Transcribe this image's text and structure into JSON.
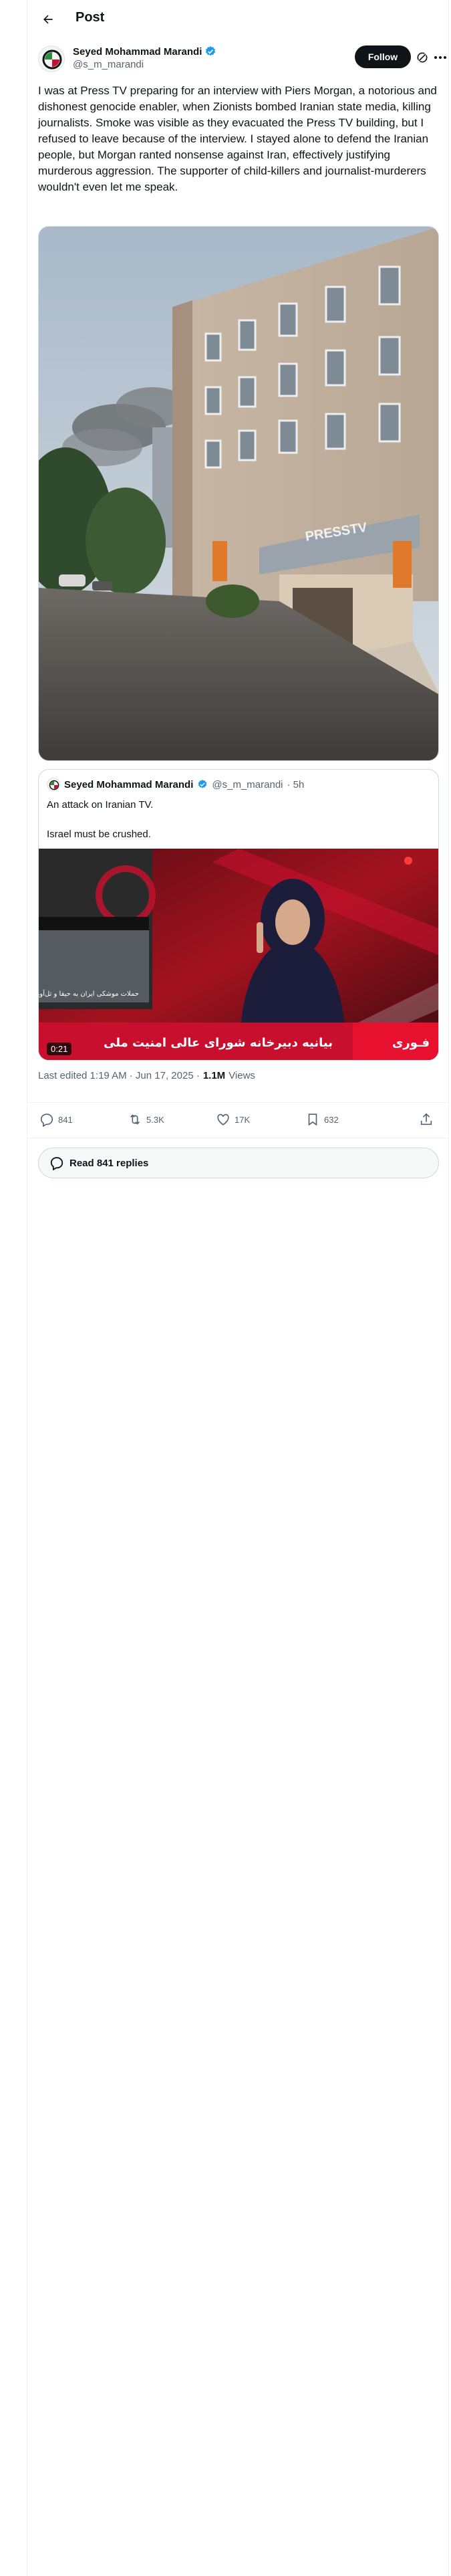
{
  "header": {
    "title": "Post"
  },
  "author": {
    "name": "Seyed Mohammad Marandi",
    "handle": "@s_m_marandi",
    "follow_label": "Follow"
  },
  "post": {
    "text": "I was at Press TV preparing for an interview with Piers Morgan, a notorious and dishonest genocide enabler, when Zionists bombed Iranian state media, killing journalists. Smoke was visible as they evacuated the Press TV building, but I refused to leave because of the interview. I stayed alone to defend the Iranian people, but Morgan ranted nonsense against Iran, effectively justifying murderous aggression. The supporter of child-killers and journalist-murderers wouldn't even let me speak.",
    "media_sign": "PRESSTV",
    "media_sign_short": "PRESS"
  },
  "quote": {
    "name": "Seyed Mohammad Marandi",
    "handle": "@s_m_marandi",
    "time": "· 5h",
    "text": "An attack on Iranian TV.\n\nIsrael must be crushed.",
    "video_duration": "0:21",
    "ticker": "بیانیه دبیرخانه شورای عالی امنیت ملی",
    "badge": "فـوری",
    "inset_caption": "حملات موشکی ایران به حیفا و تل‌آویو"
  },
  "meta": {
    "edited": "Last edited 1:19 AM · Jun 17, 2025 ·",
    "views_count": "1.1M",
    "views_label": "Views"
  },
  "actions": {
    "replies": "841",
    "reposts": "5.3K",
    "likes": "17K",
    "bookmarks": "632"
  },
  "read_replies": "Read 841 replies",
  "colors": {
    "verified": "#1d9bf0",
    "text": "#0f1419",
    "secondary": "#536471",
    "ticker_red": "#c8102e"
  },
  "icons": [
    "back-arrow-icon",
    "verified-badge-icon",
    "grok-icon",
    "more-icon",
    "reply-icon",
    "repost-icon",
    "like-icon",
    "bookmark-icon",
    "share-icon",
    "chat-bubble-icon"
  ]
}
